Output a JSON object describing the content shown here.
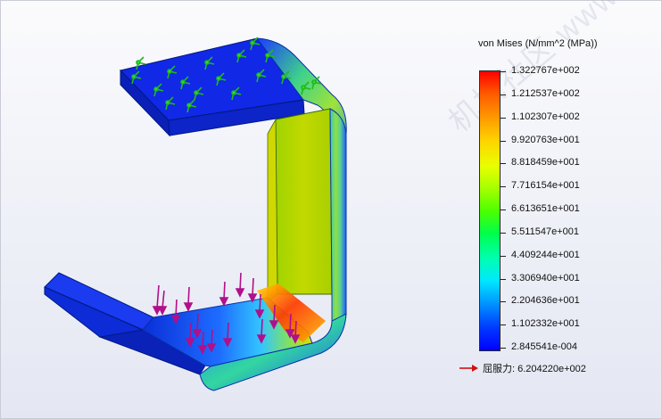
{
  "legend": {
    "title": "von Mises (N/mm^2 (MPa))",
    "tick_labels": [
      "1.322767e+002",
      "1.212537e+002",
      "1.102307e+002",
      "9.920763e+001",
      "8.818459e+001",
      "7.716154e+001",
      "6.613651e+001",
      "5.511547e+001",
      "4.409244e+001",
      "3.306940e+001",
      "2.204636e+001",
      "1.102332e+001",
      "2.845541e-004"
    ]
  },
  "yield": {
    "label": "屈服力: 6.204220e+002",
    "arrow_color": "#d01010"
  },
  "watermark": {
    "text": "机械社区 www.iCAx.com"
  },
  "model": {
    "fixture_icon": "green-fixture-arrow-icon",
    "load_icon": "magenta-load-arrow-icon",
    "fixture_color": "#22cc22",
    "load_color": "#b0108a"
  }
}
